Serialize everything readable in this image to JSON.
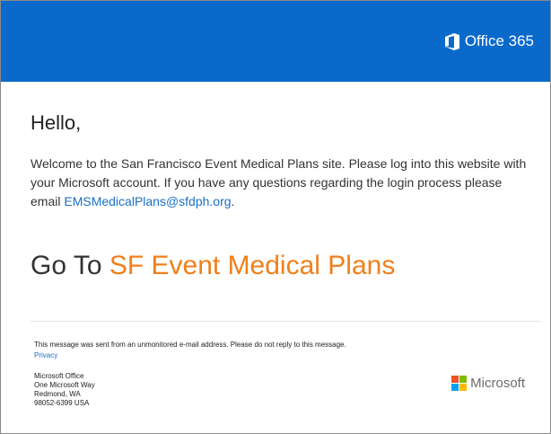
{
  "header": {
    "brand_name": "Office 365",
    "brand_icon": "office-logo-icon",
    "background": "#0a6acb"
  },
  "main": {
    "greeting": "Hello,",
    "body_text": "Welcome to the San Francisco Event Medical  Plans site. Please log into this website with your Microsoft account. If you have any questions regarding the login process please email ",
    "email": "EMSMedicalPlans@sfdph.org",
    "body_end": ".",
    "cta_prefix": "Go To ",
    "cta_link": "SF Event  Medical  Plans",
    "cta_color": "#f07f1a",
    "link_color": "#1a70c4"
  },
  "footer": {
    "notice": "This message was sent from an unmonitored e-mail address. Please do not reply to this message.",
    "privacy": "Privacy",
    "address": [
      "Microsoft Office",
      "One Microsoft Way",
      "Redmond, WA",
      "98052-6399 USA"
    ],
    "ms_logo_text": "Microsoft",
    "ms_logo_icon": "microsoft-logo-icon",
    "ms_colors": [
      "#f25022",
      "#7fba00",
      "#00a4ef",
      "#ffb900"
    ]
  }
}
